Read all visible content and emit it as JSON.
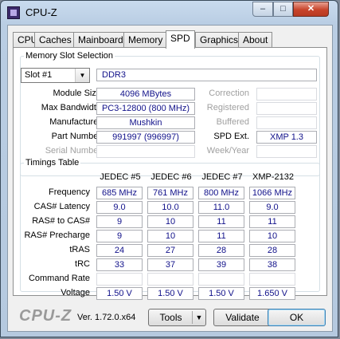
{
  "window": {
    "title": "CPU-Z",
    "min": "–",
    "max": "□",
    "close": "✕"
  },
  "tabs": [
    "CPU",
    "Caches",
    "Mainboard",
    "Memory",
    "SPD",
    "Graphics",
    "About"
  ],
  "active_tab": "SPD",
  "slot_section": {
    "title": "Memory Slot Selection",
    "slot_selected": "Slot #1",
    "memory_type": "DDR3",
    "rows": [
      {
        "label": "Module Size",
        "value": "4096 MBytes",
        "right_label": "Correction",
        "right_value": ""
      },
      {
        "label": "Max Bandwidth",
        "value": "PC3-12800 (800 MHz)",
        "right_label": "Registered",
        "right_value": ""
      },
      {
        "label": "Manufacturer",
        "value": "Mushkin",
        "right_label": "Buffered",
        "right_value": ""
      },
      {
        "label": "Part Number",
        "value": "991997 (996997)",
        "right_label": "SPD Ext.",
        "right_value": "XMP 1.3"
      },
      {
        "label": "Serial Number",
        "value": "",
        "right_label": "Week/Year",
        "right_value": ""
      }
    ]
  },
  "timings": {
    "title": "Timings Table",
    "columns": [
      "JEDEC #5",
      "JEDEC #6",
      "JEDEC #7",
      "XMP-2132"
    ],
    "rows": [
      {
        "label": "Frequency",
        "values": [
          "685 MHz",
          "761 MHz",
          "800 MHz",
          "1066 MHz"
        ]
      },
      {
        "label": "CAS# Latency",
        "values": [
          "9.0",
          "10.0",
          "11.0",
          "9.0"
        ]
      },
      {
        "label": "RAS# to CAS#",
        "values": [
          "9",
          "10",
          "11",
          "11"
        ]
      },
      {
        "label": "RAS# Precharge",
        "values": [
          "9",
          "10",
          "11",
          "10"
        ]
      },
      {
        "label": "tRAS",
        "values": [
          "24",
          "27",
          "28",
          "28"
        ]
      },
      {
        "label": "tRC",
        "values": [
          "33",
          "37",
          "39",
          "38"
        ]
      },
      {
        "label": "Command Rate",
        "values": [
          "",
          "",
          "",
          ""
        ]
      },
      {
        "label": "Voltage",
        "values": [
          "1.50 V",
          "1.50 V",
          "1.50 V",
          "1.650 V"
        ]
      }
    ]
  },
  "footer": {
    "brand": "CPU-Z",
    "version": "Ver. 1.72.0.x64",
    "tools_label": "Tools",
    "validate_label": "Validate",
    "ok_label": "OK"
  },
  "colors": {
    "value_text": "#11118a",
    "dim_label": "#a0a0a0",
    "window_frame": "#b9cde3"
  }
}
